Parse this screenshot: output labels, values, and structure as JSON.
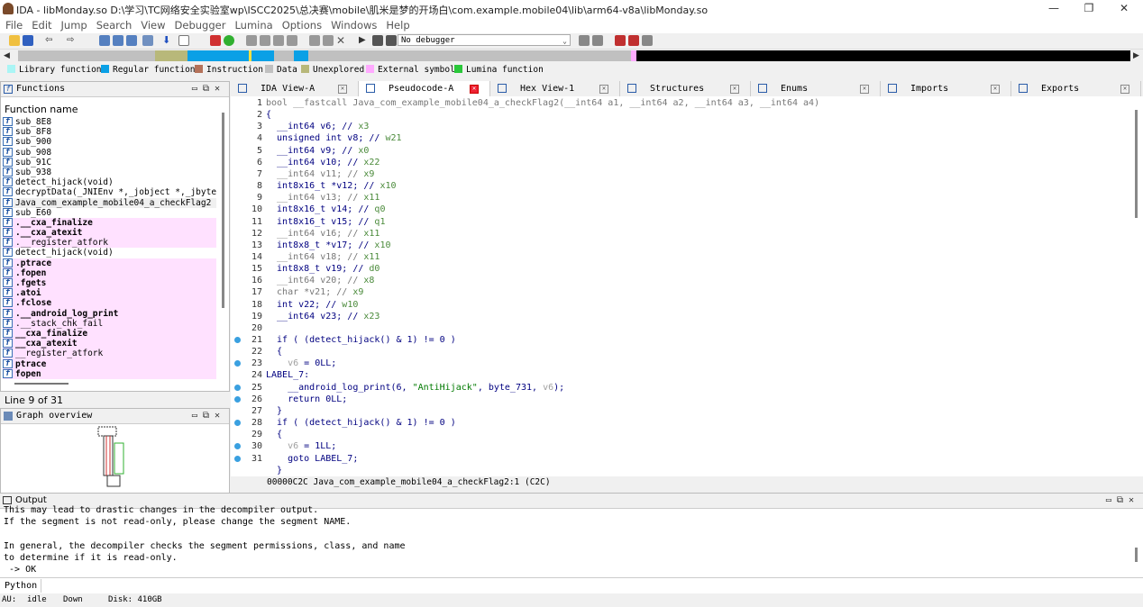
{
  "window": {
    "title": "IDA - libMonday.so D:\\学习\\TC网络安全实验室wp\\ISCC2025\\总决赛\\mobile\\肌米是梦的开场白\\com.example.mobile04\\lib\\arm64-v8a\\libMonday.so",
    "min": "—",
    "restore": "❐",
    "close": "✕"
  },
  "menu": [
    "File",
    "Edit",
    "Jump",
    "Search",
    "View",
    "Debugger",
    "Lumina",
    "Options",
    "Windows",
    "Help"
  ],
  "toolbar": {
    "debugger_select": "No debugger"
  },
  "legend": [
    {
      "label": "Library function",
      "color": "#aaf5f5"
    },
    {
      "label": "Regular function",
      "color": "#0aa0e6"
    },
    {
      "label": "Instruction",
      "color": "#b4725a"
    },
    {
      "label": "Data",
      "color": "#c0c0c0"
    },
    {
      "label": "Unexplored",
      "color": "#b8b87a"
    },
    {
      "label": "External symbol",
      "color": "#ffaaff"
    },
    {
      "label": "Lumina function",
      "color": "#2ac83a"
    }
  ],
  "functions": {
    "title": "Functions",
    "header": "Function name",
    "items": [
      {
        "name": "sub_8E8",
        "kind": "normal"
      },
      {
        "name": "sub_8F8",
        "kind": "normal"
      },
      {
        "name": "sub_900",
        "kind": "normal"
      },
      {
        "name": "sub_908",
        "kind": "normal"
      },
      {
        "name": "sub_91C",
        "kind": "normal"
      },
      {
        "name": "sub_938",
        "kind": "normal"
      },
      {
        "name": "detect_hijack(void)",
        "kind": "normal"
      },
      {
        "name": "decryptData(_JNIEnv *,_jobject *,_jbyteAr",
        "kind": "normal"
      },
      {
        "name": "Java_com_example_mobile04_a_checkFlag2",
        "kind": "selected"
      },
      {
        "name": "sub_E60",
        "kind": "normal"
      },
      {
        "name": ".__cxa_finalize",
        "kind": "lib-bold"
      },
      {
        "name": ".__cxa_atexit",
        "kind": "lib-bold"
      },
      {
        "name": ".__register_atfork",
        "kind": "lib"
      },
      {
        "name": "detect_hijack(void)",
        "kind": "normal"
      },
      {
        "name": ".ptrace",
        "kind": "lib-bold"
      },
      {
        "name": ".fopen",
        "kind": "lib-bold"
      },
      {
        "name": ".fgets",
        "kind": "lib-bold"
      },
      {
        "name": ".atoi",
        "kind": "lib-bold"
      },
      {
        "name": ".fclose",
        "kind": "lib-bold"
      },
      {
        "name": ".__android_log_print",
        "kind": "lib-bold"
      },
      {
        "name": ".__stack_chk_fail",
        "kind": "lib"
      },
      {
        "name": "__cxa_finalize",
        "kind": "lib-bold"
      },
      {
        "name": "__cxa_atexit",
        "kind": "lib-bold"
      },
      {
        "name": "__register_atfork",
        "kind": "lib"
      },
      {
        "name": "ptrace",
        "kind": "lib-bold"
      },
      {
        "name": "fopen",
        "kind": "lib-bold"
      }
    ],
    "status": "Line 9 of 31"
  },
  "graph": {
    "title": "Graph overview"
  },
  "tabs": [
    {
      "label": "IDA View-A",
      "active": false
    },
    {
      "label": "Pseudocode-A",
      "active": true
    },
    {
      "label": "Hex View-1",
      "active": false
    },
    {
      "label": "Structures",
      "active": false
    },
    {
      "label": "Enums",
      "active": false
    },
    {
      "label": "Imports",
      "active": false
    },
    {
      "label": "Exports",
      "active": false
    }
  ],
  "code": {
    "lines": [
      {
        "n": "1",
        "dot": false,
        "segs": [
          [
            "gr",
            "bool __fastcall Java_com_example_mobile04_a_checkFlag2(__int64 a1, __int64 a2, __int64 a3, __int64 a4)"
          ]
        ]
      },
      {
        "n": "2",
        "dot": false,
        "segs": [
          [
            "t",
            "{"
          ]
        ]
      },
      {
        "n": "3",
        "dot": false,
        "segs": [
          [
            "t",
            "  __int64 v6; // "
          ],
          [
            "cm",
            "x3"
          ]
        ]
      },
      {
        "n": "4",
        "dot": false,
        "segs": [
          [
            "t",
            "  unsigned int v8; // "
          ],
          [
            "cm",
            "w21"
          ]
        ]
      },
      {
        "n": "5",
        "dot": false,
        "segs": [
          [
            "t",
            "  __int64 v9; // "
          ],
          [
            "cm",
            "x0"
          ]
        ]
      },
      {
        "n": "6",
        "dot": false,
        "segs": [
          [
            "t",
            "  __int64 v10; // "
          ],
          [
            "cm",
            "x22"
          ]
        ]
      },
      {
        "n": "7",
        "dot": false,
        "segs": [
          [
            "gr",
            "  __int64 v11; // "
          ],
          [
            "cm",
            "x9"
          ]
        ]
      },
      {
        "n": "8",
        "dot": false,
        "segs": [
          [
            "t",
            "  int8x16_t *v12; // "
          ],
          [
            "cm",
            "x10"
          ]
        ]
      },
      {
        "n": "9",
        "dot": false,
        "segs": [
          [
            "gr",
            "  __int64 v13; // "
          ],
          [
            "cm",
            "x11"
          ]
        ]
      },
      {
        "n": "10",
        "dot": false,
        "segs": [
          [
            "t",
            "  int8x16_t v14; // "
          ],
          [
            "cm",
            "q0"
          ]
        ]
      },
      {
        "n": "11",
        "dot": false,
        "segs": [
          [
            "t",
            "  int8x16_t v15; // "
          ],
          [
            "cm",
            "q1"
          ]
        ]
      },
      {
        "n": "12",
        "dot": false,
        "segs": [
          [
            "gr",
            "  __int64 v16; // "
          ],
          [
            "cm",
            "x11"
          ]
        ]
      },
      {
        "n": "13",
        "dot": false,
        "segs": [
          [
            "t",
            "  int8x8_t *v17; // "
          ],
          [
            "cm",
            "x10"
          ]
        ]
      },
      {
        "n": "14",
        "dot": false,
        "segs": [
          [
            "gr",
            "  __int64 v18; // "
          ],
          [
            "cm",
            "x11"
          ]
        ]
      },
      {
        "n": "15",
        "dot": false,
        "segs": [
          [
            "t",
            "  int8x8_t v19; // "
          ],
          [
            "cm",
            "d0"
          ]
        ]
      },
      {
        "n": "16",
        "dot": false,
        "segs": [
          [
            "gr",
            "  __int64 v20; // "
          ],
          [
            "cm",
            "x8"
          ]
        ]
      },
      {
        "n": "17",
        "dot": false,
        "segs": [
          [
            "gr",
            "  char *v21; // "
          ],
          [
            "cm",
            "x9"
          ]
        ]
      },
      {
        "n": "18",
        "dot": false,
        "segs": [
          [
            "t",
            "  int v22; // "
          ],
          [
            "cm",
            "w10"
          ]
        ]
      },
      {
        "n": "19",
        "dot": false,
        "segs": [
          [
            "t",
            "  __int64 v23; // "
          ],
          [
            "cm",
            "x23"
          ]
        ]
      },
      {
        "n": "20",
        "dot": false,
        "segs": [
          [
            "t",
            ""
          ]
        ]
      },
      {
        "n": "21",
        "dot": true,
        "segs": [
          [
            "t",
            "  if ( (detect_hijack() & 1) != 0 )"
          ]
        ]
      },
      {
        "n": "22",
        "dot": false,
        "segs": [
          [
            "t",
            "  {"
          ]
        ]
      },
      {
        "n": "23",
        "dot": true,
        "segs": [
          [
            "t",
            "    "
          ],
          [
            "var",
            "v6"
          ],
          [
            "t",
            " = 0LL;"
          ]
        ]
      },
      {
        "n": "24",
        "dot": false,
        "segs": [
          [
            "t",
            "LABEL_7:"
          ]
        ]
      },
      {
        "n": "25",
        "dot": true,
        "segs": [
          [
            "t",
            "    __android_log_print(6, "
          ],
          [
            "str",
            "\"AntiHijack\""
          ],
          [
            "t",
            ", byte_731, "
          ],
          [
            "var",
            "v6"
          ],
          [
            "t",
            ");"
          ]
        ]
      },
      {
        "n": "26",
        "dot": true,
        "segs": [
          [
            "t",
            "    return 0LL;"
          ]
        ]
      },
      {
        "n": "27",
        "dot": false,
        "segs": [
          [
            "t",
            "  }"
          ]
        ]
      },
      {
        "n": "28",
        "dot": true,
        "segs": [
          [
            "t",
            "  if ( (detect_hijack() & 1) != 0 )"
          ]
        ]
      },
      {
        "n": "29",
        "dot": false,
        "segs": [
          [
            "t",
            "  {"
          ]
        ]
      },
      {
        "n": "30",
        "dot": true,
        "segs": [
          [
            "t",
            "    "
          ],
          [
            "var",
            "v6"
          ],
          [
            "t",
            " = 1LL;"
          ]
        ]
      },
      {
        "n": "31",
        "dot": true,
        "segs": [
          [
            "t",
            "    goto LABEL_7;"
          ]
        ]
      },
      {
        "n": "",
        "dot": false,
        "segs": [
          [
            "t",
            "  }"
          ]
        ]
      }
    ],
    "status": "00000C2C Java_com_example_mobile04_a_checkFlag2:1 (C2C)"
  },
  "output": {
    "title": "Output",
    "text": "This may lead to drastic changes in the decompiler output.\nIf the segment is not read-only, please change the segment NAME.\n\nIn general, the decompiler checks the segment permissions, class, and name\nto determine if it is read-only.\n -> OK"
  },
  "python_button": "Python",
  "statusbar": {
    "au": "AU:",
    "state": "idle",
    "direction": "Down",
    "disk": "Disk: 410GB"
  }
}
